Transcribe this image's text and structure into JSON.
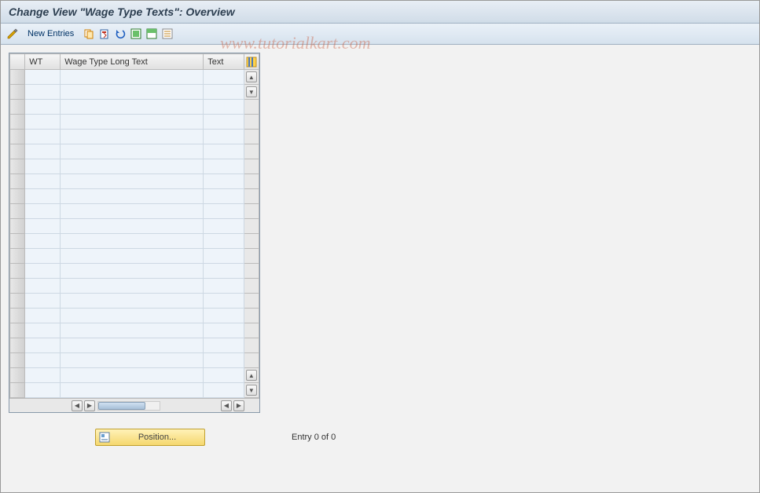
{
  "title": "Change View \"Wage Type Texts\": Overview",
  "toolbar": {
    "new_entries_label": "New Entries"
  },
  "watermark": "www.tutorialkart.com",
  "table": {
    "columns": {
      "wt": "WT",
      "long_text": "Wage Type Long Text",
      "text": "Text"
    },
    "rows": [
      {
        "wt": "",
        "long_text": "",
        "text": ""
      },
      {
        "wt": "",
        "long_text": "",
        "text": ""
      },
      {
        "wt": "",
        "long_text": "",
        "text": ""
      },
      {
        "wt": "",
        "long_text": "",
        "text": ""
      },
      {
        "wt": "",
        "long_text": "",
        "text": ""
      },
      {
        "wt": "",
        "long_text": "",
        "text": ""
      },
      {
        "wt": "",
        "long_text": "",
        "text": ""
      },
      {
        "wt": "",
        "long_text": "",
        "text": ""
      },
      {
        "wt": "",
        "long_text": "",
        "text": ""
      },
      {
        "wt": "",
        "long_text": "",
        "text": ""
      },
      {
        "wt": "",
        "long_text": "",
        "text": ""
      },
      {
        "wt": "",
        "long_text": "",
        "text": ""
      },
      {
        "wt": "",
        "long_text": "",
        "text": ""
      },
      {
        "wt": "",
        "long_text": "",
        "text": ""
      },
      {
        "wt": "",
        "long_text": "",
        "text": ""
      },
      {
        "wt": "",
        "long_text": "",
        "text": ""
      },
      {
        "wt": "",
        "long_text": "",
        "text": ""
      },
      {
        "wt": "",
        "long_text": "",
        "text": ""
      },
      {
        "wt": "",
        "long_text": "",
        "text": ""
      },
      {
        "wt": "",
        "long_text": "",
        "text": ""
      },
      {
        "wt": "",
        "long_text": "",
        "text": ""
      },
      {
        "wt": "",
        "long_text": "",
        "text": ""
      }
    ]
  },
  "footer": {
    "position_label": "Position...",
    "entry_status": "Entry 0 of 0"
  }
}
